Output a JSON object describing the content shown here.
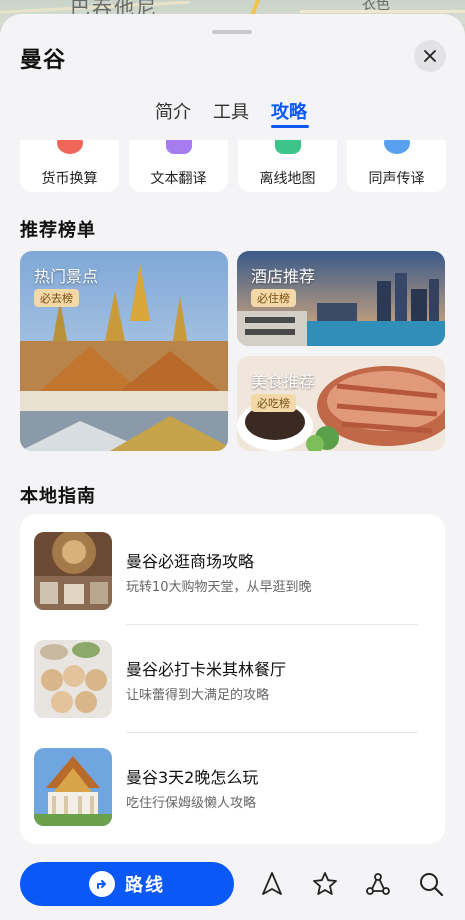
{
  "map": {
    "place_name": "巴吞他尼",
    "place_name_2": "衣色"
  },
  "header": {
    "title": "曼谷",
    "close_icon": "close-icon"
  },
  "tabs": [
    {
      "label": "简介"
    },
    {
      "label": "工具"
    },
    {
      "label": "攻略",
      "active": true
    }
  ],
  "tools": [
    {
      "label": "货币换算",
      "icon": "currency-icon",
      "color": "#f0675a"
    },
    {
      "label": "文本翻译",
      "icon": "translate-icon",
      "color": "#a67cf0"
    },
    {
      "label": "离线地图",
      "icon": "offline-map-icon",
      "color": "#3cc48a"
    },
    {
      "label": "同声传译",
      "icon": "interpret-icon",
      "color": "#5aa0f0"
    }
  ],
  "recommend": {
    "section_title": "推荐榜单",
    "cards": [
      {
        "label": "热门景点",
        "badge": "必去榜"
      },
      {
        "label": "酒店推荐",
        "badge": "必住榜"
      },
      {
        "label": "美食推荐",
        "badge": "必吃榜"
      }
    ]
  },
  "guide": {
    "section_title": "本地指南",
    "items": [
      {
        "title": "曼谷必逛商场攻略",
        "subtitle": "玩转10大购物天堂，从早逛到晚"
      },
      {
        "title": "曼谷必打卡米其林餐厅",
        "subtitle": "让味蕾得到大满足的攻略"
      },
      {
        "title": "曼谷3天2晚怎么玩",
        "subtitle": "吃住行保姆级懒人攻略"
      }
    ]
  },
  "bottom_bar": {
    "route_label": "路线",
    "icons": [
      "navigate-icon",
      "star-icon",
      "share-route-icon",
      "search-icon"
    ]
  },
  "colors": {
    "accent": "#0a59f7",
    "sheet_bg": "#f4f4f6"
  }
}
